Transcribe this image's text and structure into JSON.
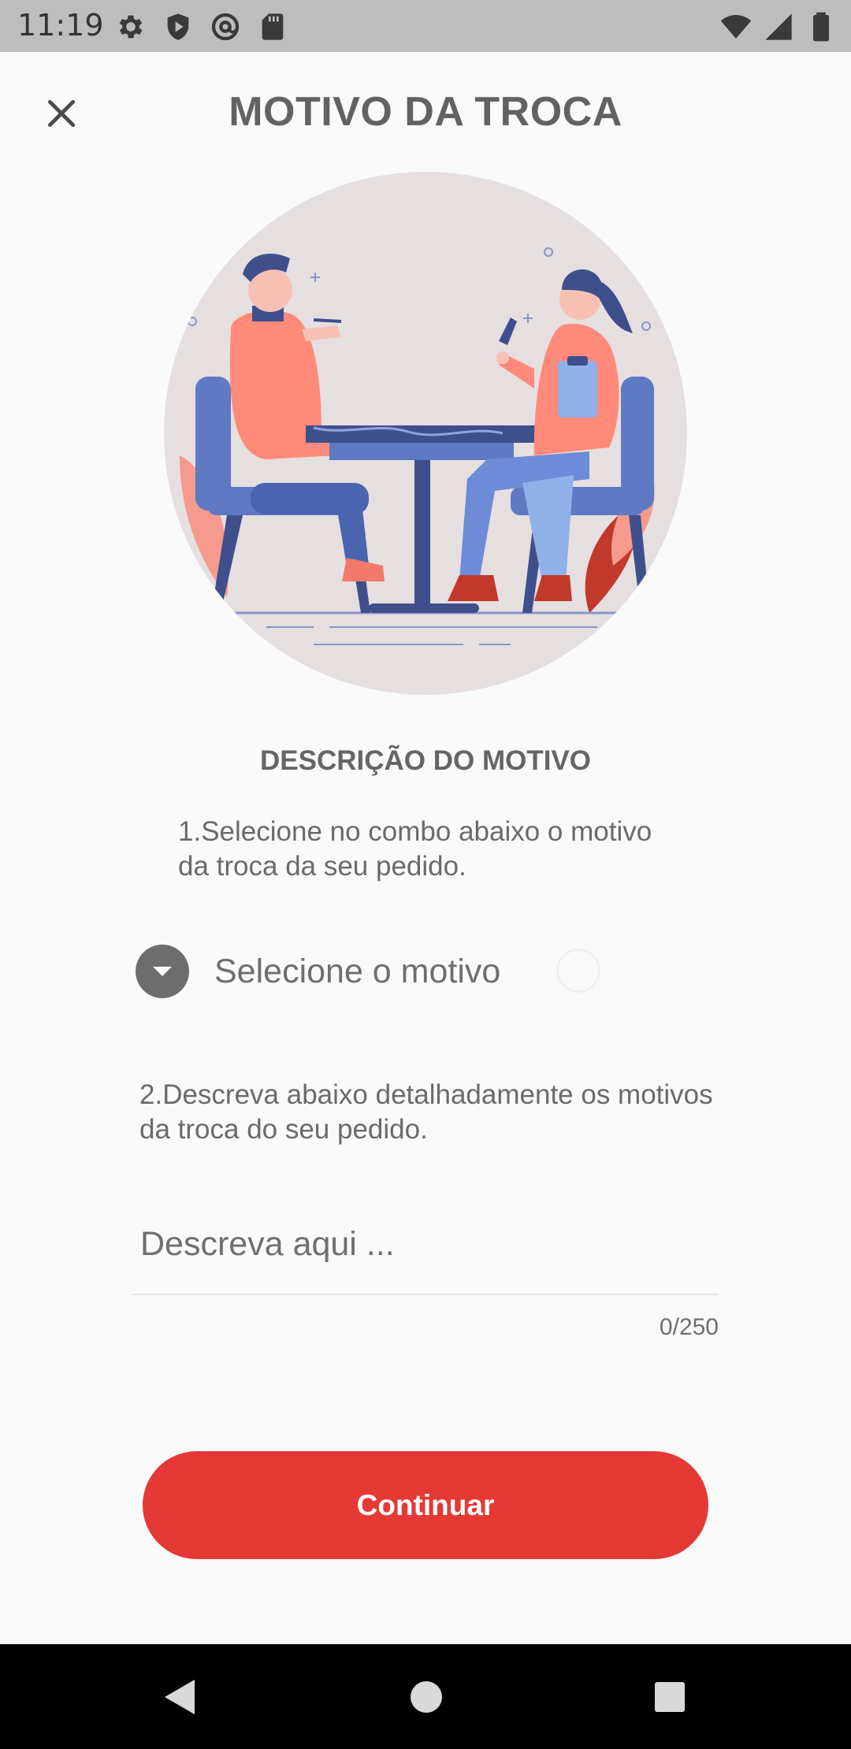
{
  "status_bar": {
    "time": "11:19",
    "left_icons": [
      "gear-icon",
      "shield-icon",
      "at-sign-icon",
      "sd-card-icon"
    ],
    "right_icons": [
      "wifi-icon",
      "signal-icon",
      "battery-icon"
    ]
  },
  "header": {
    "title": "MOTIVO DA TROCA",
    "close_icon": "close-icon"
  },
  "content": {
    "section_title": "DESCRIÇÃO DO MOTIVO",
    "step1_text": "1.Selecione no combo abaixo o motivo da troca da seu pedido.",
    "select": {
      "icon": "chevron-down-icon",
      "label": "Selecione o motivo"
    },
    "step2_text": "2.Descreva abaixo detalhadamente os motivos da troca do seu pedido.",
    "description_input": {
      "placeholder": "Descreva aqui ...",
      "value": ""
    },
    "char_counter": "0/250",
    "continue_label": "Continuar"
  },
  "colors": {
    "primary": "#e53935",
    "illustration_bg": "#e6dfe0",
    "status_bar": "#bdbdbd",
    "nav_bar": "#000000"
  },
  "nav_bar": {
    "buttons": [
      "back-icon",
      "home-icon",
      "recents-icon"
    ]
  }
}
